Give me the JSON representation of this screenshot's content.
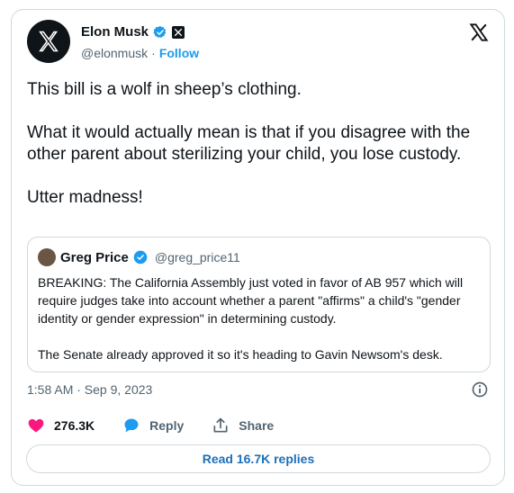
{
  "author": {
    "name": "Elon Musk",
    "handle": "@elonmusk",
    "separator": "·",
    "follow_label": "Follow"
  },
  "tweet": {
    "paragraphs": [
      "This bill is a wolf in sheep’s clothing.",
      "What it would actually mean is that if you disagree with the other parent about sterilizing your child, you lose custody.",
      "Utter madness!"
    ]
  },
  "quote": {
    "name": "Greg Price",
    "handle": "@greg_price11",
    "paragraphs": [
      "BREAKING: The California Assembly just voted in favor of AB 957 which will require judges take into account whether a parent \"affirms\" a child's \"gender identity or gender expression\" in determining custody.",
      "The Senate already approved it so it's heading to Gavin Newsom's desk."
    ]
  },
  "meta": {
    "timestamp": "1:58 AM · Sep 9, 2023"
  },
  "actions": {
    "likes": "276.3K",
    "reply_label": "Reply",
    "share_label": "Share"
  },
  "read_replies": "Read 16.7K replies",
  "colors": {
    "accent": "#1d9bf0",
    "like": "#f91880",
    "text": "#0f1419",
    "muted": "#536471",
    "border": "#cfd9de"
  },
  "icons": {
    "logo": "x-logo-icon",
    "verified": "verified-badge-icon",
    "affiliate": "x-affiliate-badge-icon",
    "like": "heart-icon",
    "reply": "reply-bubble-icon",
    "share": "share-icon",
    "info": "info-icon"
  }
}
